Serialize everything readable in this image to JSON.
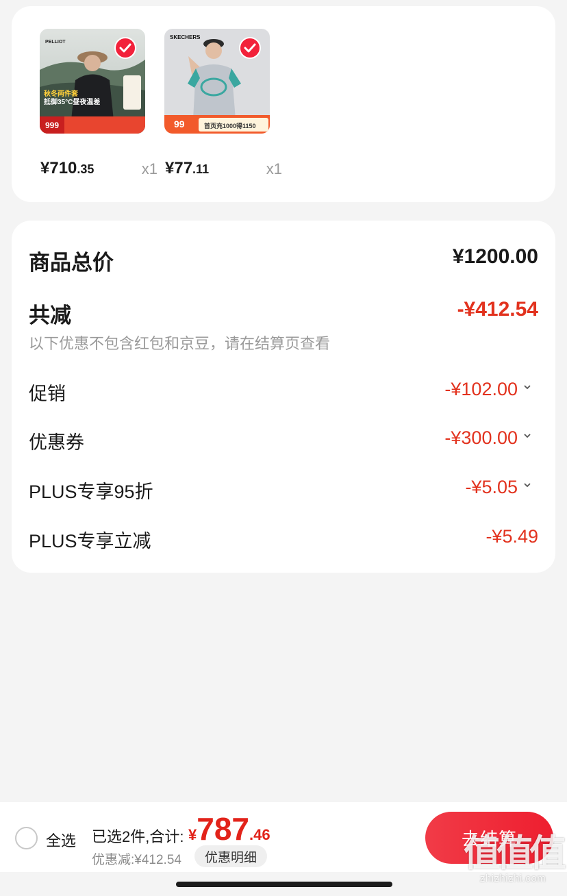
{
  "products": [
    {
      "name": "product-pelliot-jacket",
      "brand_text": "PELLIOT",
      "promo_lines": [
        "秋冬两件套",
        "抵御35°C昼夜温差"
      ],
      "badge_price": "999",
      "price_int": "¥710",
      "price_dec": ".35",
      "qty": "x1"
    },
    {
      "name": "product-skechers-tee",
      "brand_text": "SKECHERS",
      "badge_price": "99",
      "promo_line": "首页充1000得1150",
      "price_int": "¥77",
      "price_dec": ".11",
      "qty": "x1"
    }
  ],
  "summary": {
    "total_label": "商品总价",
    "total_value": "¥1200.00",
    "reduce_label": "共减",
    "reduce_value": "-¥412.54",
    "note": "以下优惠不包含红包和京豆，请在结算页查看",
    "items": [
      {
        "label": "促销",
        "value": "-¥102.00"
      },
      {
        "label": "优惠券",
        "value": "-¥300.00"
      },
      {
        "label": "PLUS专享95折",
        "value": "-¥5.05"
      },
      {
        "label": "PLUS专享立减",
        "value": "-¥5.49"
      }
    ]
  },
  "bottom": {
    "select_all": "全选",
    "selected_count": "已选2件,合计:",
    "total_currency": "¥",
    "total_int": "787",
    "total_dec": ".46",
    "discount": "优惠减:¥412.54",
    "detail_button": "优惠明细",
    "checkout": "去结算"
  },
  "watermark": {
    "mark": "值值值",
    "url": "zhizhizhi.com"
  },
  "colors": {
    "accent_red": "#e2321e",
    "button_red": "#f13b47",
    "background": "#f4f4f4"
  }
}
